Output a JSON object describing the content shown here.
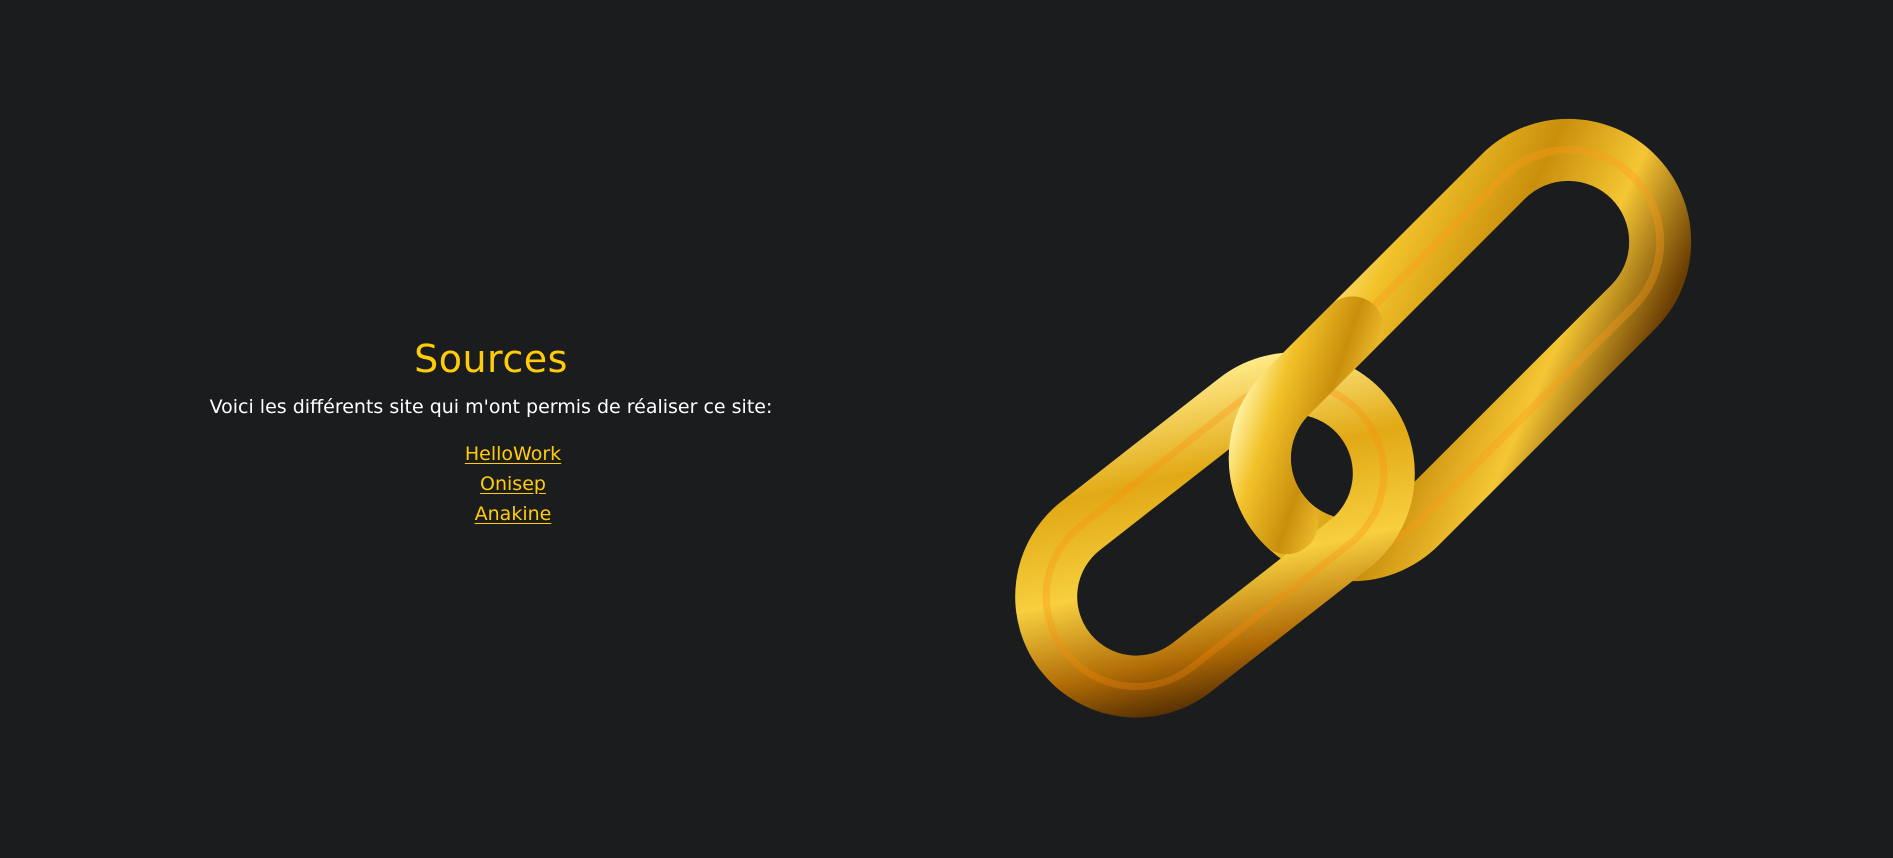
{
  "sources": {
    "title": "Sources",
    "intro": "Voici les différents site qui m'ont permis de réaliser ce site:",
    "links": [
      {
        "label": "HelloWork"
      },
      {
        "label": "Onisep"
      },
      {
        "label": "Anakine"
      }
    ]
  },
  "image": {
    "icon": "gold-chain-link-illustration"
  },
  "colors": {
    "background": "#1b1c1e",
    "accent": "#ffcc0a",
    "text": "#ffffff"
  }
}
